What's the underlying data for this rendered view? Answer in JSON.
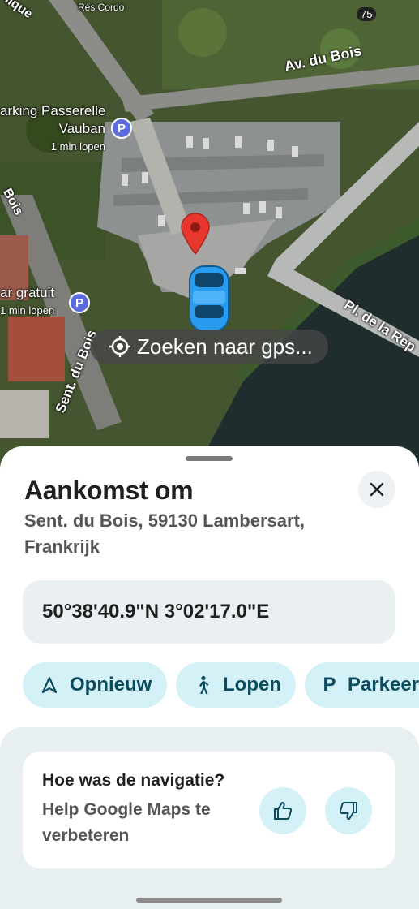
{
  "status_bar": {
    "battery": "75"
  },
  "map": {
    "road_labels": {
      "av_du_bois": "Av. du Bois",
      "sent_du_bois": "Sent. du Bois",
      "pl_de_la_rep": "Pl. de la Rép",
      "bois_left": "Bois",
      "top_left": "lique",
      "top_small": "Rés Cordo"
    },
    "parking_passerelle": {
      "name_line1": "arking Passerelle",
      "name_line2": "Vauban",
      "walk": "1 min lopen",
      "badge": "P"
    },
    "parking_gratuit": {
      "name": "ar gratuit",
      "walk": "1 min lopen",
      "badge": "P"
    },
    "gps_status": "Zoeken naar gps..."
  },
  "sheet": {
    "title": "Aankomst om",
    "address": "Sent. du Bois, 59130 Lambersart, Frankrijk",
    "coordinates": "50°38'40.9\"N 3°02'17.0\"E",
    "chips": [
      {
        "label": "Opnieuw",
        "icon": "navigation-arrow-icon"
      },
      {
        "label": "Lopen",
        "icon": "walking-icon"
      },
      {
        "label": "Parkeer",
        "icon": "parking-icon"
      }
    ],
    "feedback": {
      "question": "Hoe was de navigatie?",
      "subtitle": "Help Google Maps te verbeteren"
    }
  },
  "colors": {
    "accent_chip": "#d5f1f8",
    "accent_text": "#0c4a5d",
    "pin": "#e8372c",
    "car": "#2a9cf0"
  }
}
